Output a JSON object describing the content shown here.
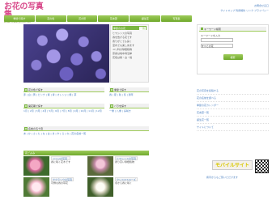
{
  "header": {
    "logo_title": "お花の写真集",
    "logo_url": "www.flower-photo.info",
    "top_link_1": "お問合せ窓口",
    "top_links_2": "サイトマップ  利用規約  リンク  プライバシー"
  },
  "nav": [
    "季節で探す",
    "花の色",
    "花の形",
    "花言葉",
    "誕生花",
    "写真集"
  ],
  "hero_side": {
    "head": "季節のお花",
    "tag": "一覧",
    "lines": [
      "ヒヤシンスの写真",
      "春を告げる花です",
      "香りがとても良く",
      "室内でも楽しめます",
      "ユリ科の球根植物",
      "原産は地中海沿岸",
      "花色は紫・白・桃"
    ]
  },
  "sections": {
    "color": {
      "title": "花の色で探す",
      "links": "赤 | 白 | 黄 | ピンク | 紫 | 青 | オレンジ | 緑 | 茶"
    },
    "season": {
      "title": "季節で探す",
      "links": "春 | 夏 | 秋 | 冬 | 通年"
    },
    "month": {
      "title": "開花期で探す",
      "links": "1月 | 2月 | 3月 | 4月 | 5月 | 6月 | 7月 | 8月 | 9月 | 10月 | 11月 | 12月"
    },
    "shape": {
      "title": "バラを探す",
      "links": "一重 | 八重 | 房咲き"
    },
    "name": {
      "title": "名前の五十音",
      "links": "あ | か | さ | た | な | は | ま | や | ら | わ | 花の名前一覧"
    }
  },
  "gallery": {
    "title": "花ごよみ",
    "cards": [
      {
        "title": "ツツジの写真",
        "text": "春に咲く花木です"
      },
      {
        "title": "ヒヤシンスの写真",
        "text": "香り高い球根植物"
      },
      {
        "title": "サクラソウの写真",
        "text": "可憐な春の草花"
      },
      {
        "title": "クリスマスローズ",
        "text": "冬から春に咲く"
      }
    ]
  },
  "search": {
    "title": "キーワード検索",
    "label": "キーワードを入力",
    "input_placeholder": "",
    "select_value": "すべての花",
    "button": "検索"
  },
  "right_links": [
    "花の写真を投稿する",
    "花の名前を調べる",
    "季節の花カレンダー",
    "花言葉一覧",
    "誕生花一覧",
    "サイトについて"
  ],
  "mobile": {
    "banner": "モバイルサイト",
    "caption": "携帯からもご覧いただけます"
  }
}
